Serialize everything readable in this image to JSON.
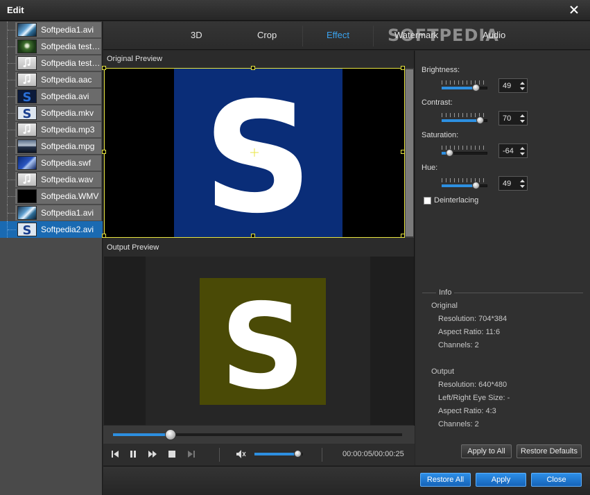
{
  "window": {
    "title": "Edit"
  },
  "files": [
    {
      "name": "Softpedia1.avi",
      "thumb": "th-video1"
    },
    {
      "name": "Softpedia test ...",
      "thumb": "th-forest"
    },
    {
      "name": "Softpedia test....",
      "thumb": "th-audio"
    },
    {
      "name": "Softpedia.aac",
      "thumb": "th-audio"
    },
    {
      "name": "Softpedia.avi",
      "thumb": "th-s-dark"
    },
    {
      "name": "Softpedia.mkv",
      "thumb": "th-s-light"
    },
    {
      "name": "Softpedia.mp3",
      "thumb": "th-audio"
    },
    {
      "name": "Softpedia.mpg",
      "thumb": "th-mpg"
    },
    {
      "name": "Softpedia.swf",
      "thumb": "th-swf"
    },
    {
      "name": "Softpedia.wav",
      "thumb": "th-audio"
    },
    {
      "name": "Softpedia.WMV",
      "thumb": "th-black"
    },
    {
      "name": "Softpedia1.avi",
      "thumb": "th-video1"
    },
    {
      "name": "Softpedia2.avi",
      "thumb": "th-s-light",
      "selected": true
    }
  ],
  "tabs": [
    "3D",
    "Crop",
    "Effect",
    "Watermark",
    "Audio"
  ],
  "active_tab": "Effect",
  "watermark_logo": "SOFTPEDIA",
  "preview": {
    "original_label": "Original Preview",
    "output_label": "Output Preview",
    "original_letter": "S",
    "output_letter": "S",
    "original_bg": "#0a2d78",
    "output_bg": "#4a4a06"
  },
  "player": {
    "timecode": "00:00:05/00:00:25",
    "seek_fraction": 0.2,
    "volume_fraction": 0.9
  },
  "effects": {
    "brightness": {
      "label": "Brightness:",
      "value": "49",
      "fraction": 0.75
    },
    "contrast": {
      "label": "Contrast:",
      "value": "70",
      "fraction": 0.85
    },
    "saturation": {
      "label": "Saturation:",
      "value": "-64",
      "fraction": 0.18
    },
    "hue": {
      "label": "Hue:",
      "value": "49",
      "fraction": 0.75
    },
    "deinterlacing_label": "Deinterlacing",
    "deinterlacing_checked": false
  },
  "info": {
    "title": "Info",
    "original_heading": "Original",
    "original_resolution": "Resolution: 704*384",
    "original_aspect": "Aspect Ratio: 11:6",
    "original_channels": "Channels: 2",
    "output_heading": "Output",
    "output_resolution": "Resolution: 640*480",
    "output_eye_size": "Left/Right Eye Size: -",
    "output_aspect": "Aspect Ratio: 4:3",
    "output_channels": "Channels: 2"
  },
  "buttons": {
    "apply_to_all": "Apply to All",
    "restore_defaults": "Restore Defaults",
    "restore_all": "Restore All",
    "apply": "Apply",
    "close": "Close"
  },
  "colors": {
    "accent": "#3aa4f0",
    "selection": "#1a6ab2",
    "crop_border": "#e8e640"
  }
}
